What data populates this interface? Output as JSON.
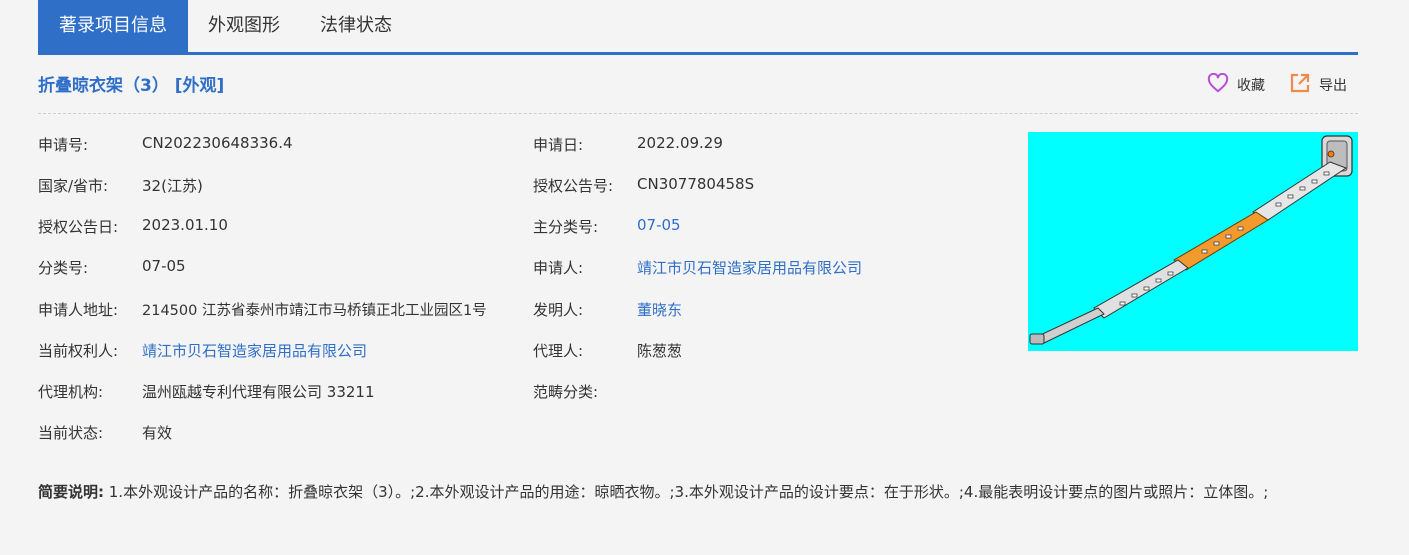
{
  "tabs": [
    "著录项目信息",
    "外观图形",
    "法律状态"
  ],
  "title": "折叠晾衣架（3） [外观]",
  "actions": {
    "favorite": "收藏",
    "export": "导出"
  },
  "fields": {
    "application_no": {
      "label": "申请号:",
      "value": "CN202230648336.4"
    },
    "country": {
      "label": "国家/省市:",
      "value": "32(江苏)"
    },
    "grant_date": {
      "label": "授权公告日:",
      "value": "2023.01.10"
    },
    "class_no": {
      "label": "分类号:",
      "value": "07-05"
    },
    "applicant_address": {
      "label": "申请人地址:",
      "value": "214500 江苏省泰州市靖江市马桥镇正北工业园区1号"
    },
    "current_owner": {
      "label": "当前权利人:",
      "value": "靖江市贝石智造家居用品有限公司"
    },
    "agency": {
      "label": "代理机构:",
      "value": "温州瓯越专利代理有限公司 33211"
    },
    "status": {
      "label": "当前状态:",
      "value": "有效"
    },
    "application_date": {
      "label": "申请日:",
      "value": "2022.09.29"
    },
    "grant_no": {
      "label": "授权公告号:",
      "value": "CN307780458S"
    },
    "main_class": {
      "label": "主分类号:",
      "value": "07-05"
    },
    "applicant": {
      "label": "申请人:",
      "value": "靖江市贝石智造家居用品有限公司"
    },
    "inventor": {
      "label": "发明人:",
      "value": "董晓东"
    },
    "agent": {
      "label": "代理人:",
      "value": "陈葱葱"
    },
    "category": {
      "label": "范畴分类:",
      "value": ""
    }
  },
  "summary": {
    "label": "简要说明:",
    "text": " 1.本外观设计产品的名称：折叠晾衣架（3）。;2.本外观设计产品的用途：晾晒衣物。;3.本外观设计产品的设计要点：在于形状。;4.最能表明设计要点的图片或照片：立体图。;"
  },
  "colors": {
    "accent": "#2f6fc8",
    "favorite": "#b84fd8",
    "export": "#f08a4b",
    "image_bg": "#00ffff"
  },
  "icons": {
    "favorite": "heart-icon",
    "export": "external-link-icon"
  }
}
